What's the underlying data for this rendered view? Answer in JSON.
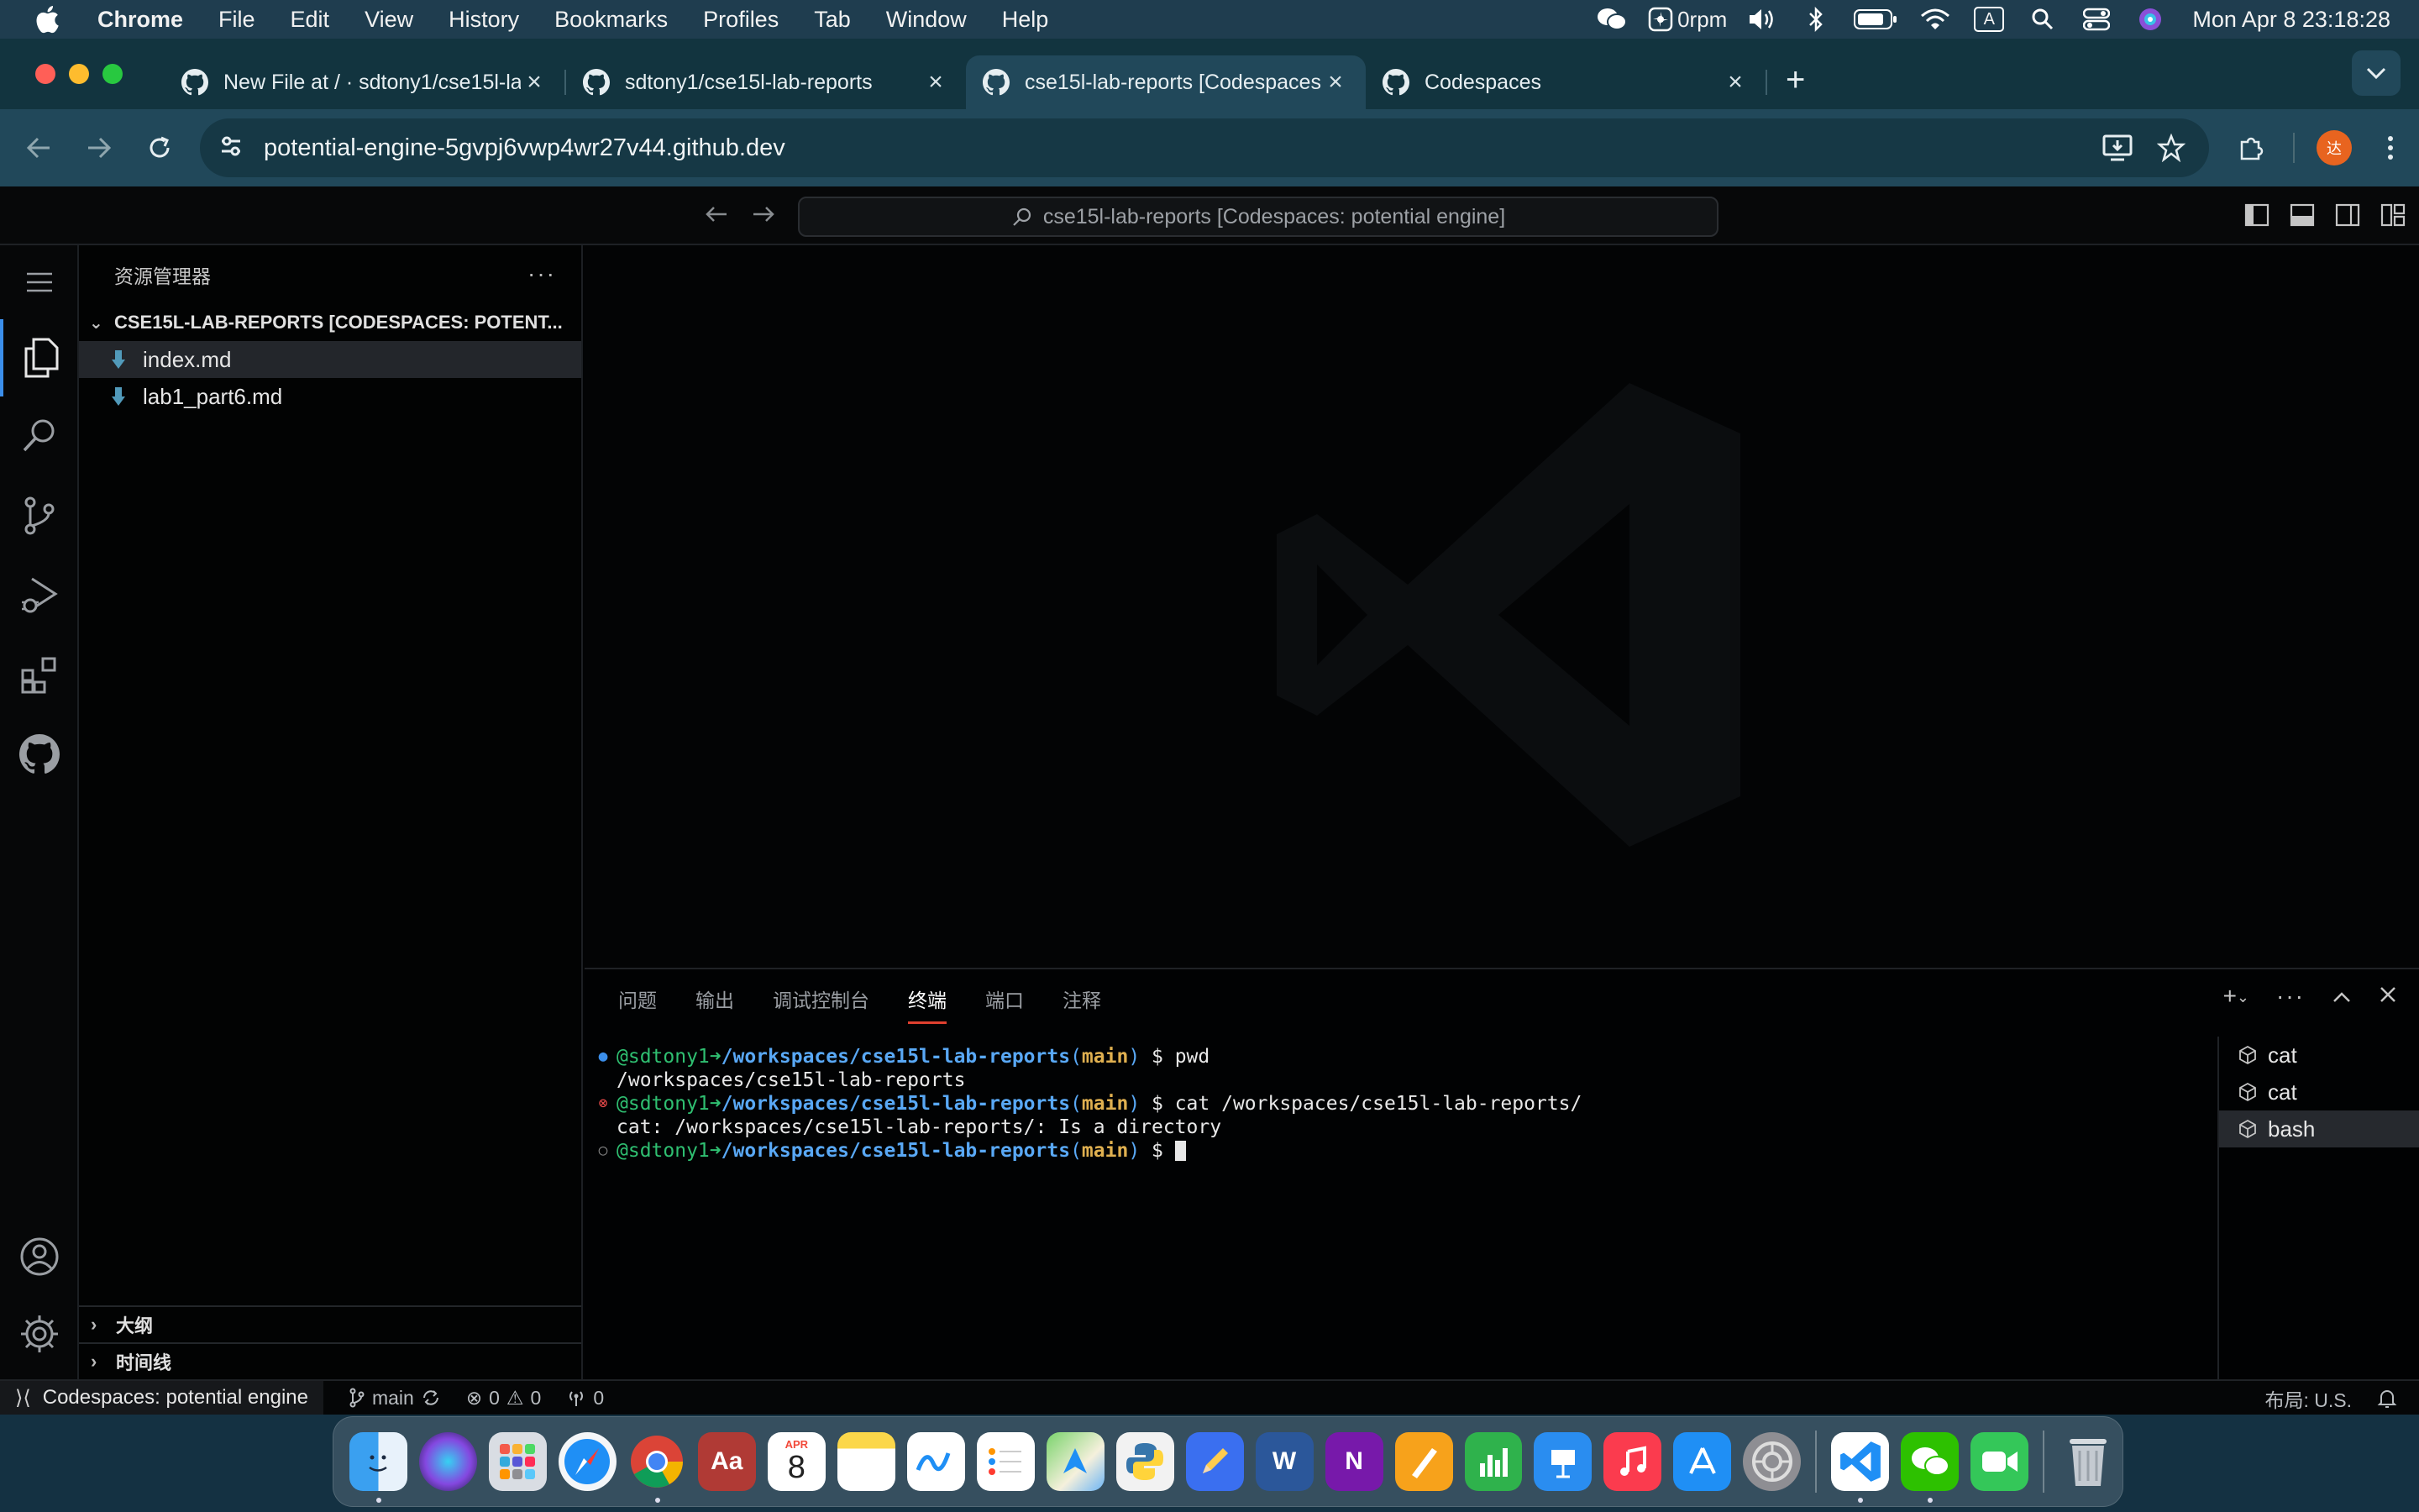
{
  "menubar": {
    "app_name": "Chrome",
    "items": [
      "File",
      "Edit",
      "View",
      "History",
      "Bookmarks",
      "Profiles",
      "Tab",
      "Window",
      "Help"
    ],
    "fan_speed": "0rpm",
    "clock": "Mon Apr 8  23:18:28",
    "input_source": "A"
  },
  "browser": {
    "tabs": [
      {
        "title": "New File at / · sdtony1/cse15l-lab-reports"
      },
      {
        "title": "sdtony1/cse15l-lab-reports"
      },
      {
        "title": "cse15l-lab-reports [Codespaces: potential engine]"
      },
      {
        "title": "Codespaces"
      }
    ],
    "url": "potential-engine-5gvpj6vwp4wr27v44.github.dev",
    "avatar_initial": "达"
  },
  "vscode": {
    "command_center": "cse15l-lab-reports [Codespaces: potential engine]",
    "sidebar": {
      "title": "资源管理器",
      "more": "···",
      "folder": "CSE15L-LAB-REPORTS [CODESPACES: POTENT...",
      "files": [
        "index.md",
        "lab1_part6.md"
      ],
      "outline": "大纲",
      "timeline": "时间线"
    },
    "panel": {
      "tabs": [
        "问题",
        "输出",
        "调试控制台",
        "终端",
        "端口",
        "注释"
      ],
      "terminal_lines": {
        "user": "@sdtony1",
        "arrow": "➜",
        "path": "/workspaces/cse15l-lab-reports",
        "branch": "main",
        "cmd1": " $ pwd",
        "out1": "/workspaces/cse15l-lab-reports",
        "cmd2": " $ cat /workspaces/cse15l-lab-reports/",
        "out2": "cat: /workspaces/cse15l-lab-reports/: Is a directory",
        "cmd3": " $ "
      },
      "terminals": [
        "cat",
        "cat",
        "bash"
      ]
    },
    "statusbar": {
      "remote": "Codespaces: potential engine",
      "branch": "main",
      "errors": "0",
      "warnings": "0",
      "ports": "0",
      "layout": "布局: U.S."
    }
  },
  "dock": {
    "calendar_month": "APR",
    "calendar_day": "8",
    "dictionary": "Aa",
    "word": "W",
    "onenote": "N"
  },
  "colors": {
    "accent": "#3b8eea",
    "terminal_tab_underline": "#e0402f",
    "prompt_user": "#2fbf71",
    "prompt_path": "#59a8f5",
    "prompt_branch": "#e0b050"
  }
}
